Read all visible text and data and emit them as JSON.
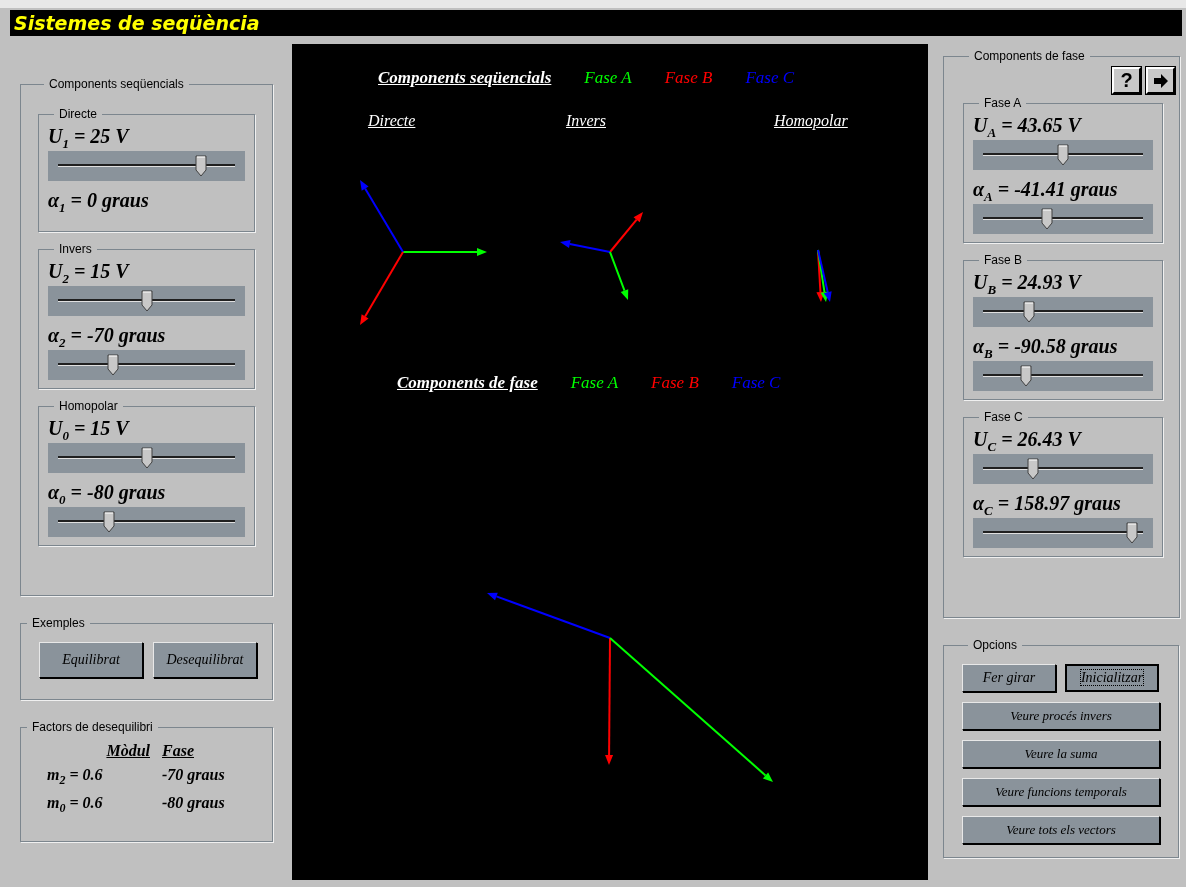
{
  "window": {
    "title": "Sistemes de seqüència"
  },
  "sequence_panel": {
    "title": "Components seqüencials",
    "groups": [
      {
        "title": "Directe",
        "rows": [
          {
            "label": "U$_{1}$ = 25 V",
            "level": 0.81
          },
          {
            "label": "α$_{1}$ = 0 graus"
          }
        ]
      },
      {
        "title": "Invers",
        "rows": [
          {
            "label": "U$_{2}$ = 15 V",
            "level": 0.5
          },
          {
            "label": "α$_{2}$ = -70 graus",
            "level": 0.31
          }
        ]
      },
      {
        "title": "Homopolar",
        "rows": [
          {
            "label": "U$_{0}$ = 15 V",
            "level": 0.5
          },
          {
            "label": "α$_{0}$ = -80 graus",
            "level": 0.29
          }
        ]
      }
    ]
  },
  "examples": {
    "title": "Exemples",
    "buttons": [
      "Equilibrat",
      "Desequilibrat"
    ]
  },
  "factors": {
    "title": "Factors de desequilibri",
    "columns": [
      "Mòdul",
      "Fase"
    ],
    "rows": [
      [
        "m$_{2}$ = 0.6",
        "-70 graus"
      ],
      [
        "m$_{0}$ = 0.6",
        "-80 graus"
      ]
    ]
  },
  "canvas": {
    "sequence_legend": {
      "title": "Components seqüencials",
      "phases": [
        {
          "label": "Fase A",
          "color": "#00ff00"
        },
        {
          "label": "Fase B",
          "color": "#ff0000"
        },
        {
          "label": "Fase C",
          "color": "#0000ff"
        }
      ]
    },
    "sequence_columns": [
      "Directe",
      "Invers",
      "Homopolar"
    ],
    "phase_legend": {
      "title": "Components de fase",
      "phases": [
        {
          "label": "Fase A",
          "color": "#00ff00"
        },
        {
          "label": "Fase B",
          "color": "#ff0000"
        },
        {
          "label": "Fase C",
          "color": "#0000ff"
        }
      ]
    }
  },
  "phase_panel": {
    "title": "Components de fase",
    "help_button": "?",
    "groups": [
      {
        "title": "Fase A",
        "rows": [
          {
            "label": "U$_{A}$ = 43.65 V",
            "level": 0.5
          },
          {
            "label": "α$_{A}$ = -41.41 graus",
            "level": 0.4
          }
        ]
      },
      {
        "title": "Fase B",
        "rows": [
          {
            "label": "U$_{B}$ = 24.93 V",
            "level": 0.29
          },
          {
            "label": "α$_{B}$ = -90.58 graus",
            "level": 0.27
          }
        ]
      },
      {
        "title": "Fase C",
        "rows": [
          {
            "label": "U$_{C}$ = 26.43 V",
            "level": 0.31
          },
          {
            "label": "α$_{C}$ = 158.97 graus",
            "level": 0.93
          }
        ]
      }
    ]
  },
  "options": {
    "title": "Opcions",
    "buttons": [
      {
        "label": "Fer girar",
        "focused": false
      },
      {
        "label": "Inicialitzar",
        "focused": true
      },
      {
        "label": "Veure procés invers",
        "focused": false
      },
      {
        "label": "Veure la suma",
        "focused": false
      },
      {
        "label": "Veure funcions temporals",
        "focused": false
      },
      {
        "label": "Veure tots els vectors",
        "focused": false
      }
    ]
  }
}
